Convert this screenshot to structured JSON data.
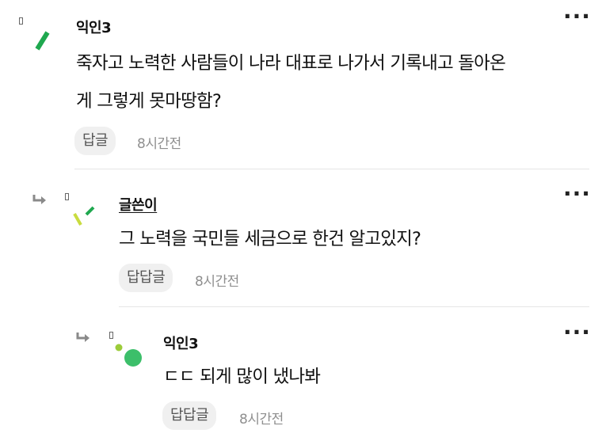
{
  "comments": [
    {
      "author": "익인3",
      "text_line1": "죽자고 노력한 사람들이 나라 대표로 나가서 기록내고 돌아온",
      "text_line2": "게 그렇게 못마땅함?",
      "reply_label": "답글",
      "time": "8시간전",
      "more": "···"
    },
    {
      "author": "글쓴이",
      "text": "그 노력을 국민들 세금으로 한건 알고있지?",
      "reply_label": "답답글",
      "time": "8시간전",
      "more": "···"
    },
    {
      "author": "익인3",
      "text": "ㄷㄷ 되게 많이 냈나봐",
      "reply_label": "답답글",
      "time": "8시간전",
      "more": "···"
    }
  ],
  "colors": {
    "avatar_green_dark": "#1fa84f",
    "avatar_green_light": "#9ccc3a",
    "avatar_yellow": "#c9dc3f",
    "avatar_circle": "#3cbf6a"
  }
}
